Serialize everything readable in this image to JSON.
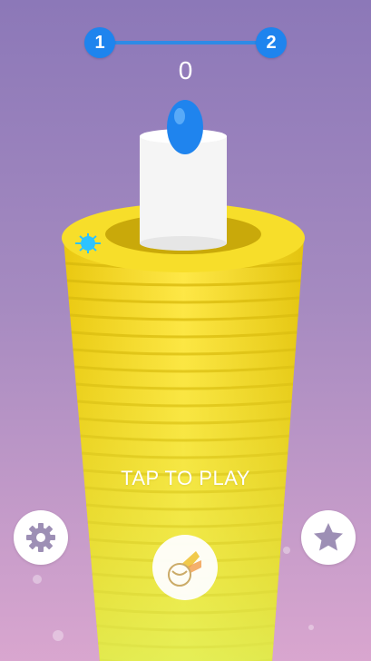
{
  "level": {
    "current": "1",
    "next": "2"
  },
  "score": "0",
  "prompt": "TAP TO PLAY",
  "buttons": {
    "settings_icon": "gear-icon",
    "favorites_icon": "star-icon",
    "ball_select_icon": "ball-icon"
  },
  "colors": {
    "background_top": "#8c78b8",
    "background_bottom": "#d9a6cf",
    "tower": "#f5d71a",
    "ball": "#1f84ee",
    "level_indicator": "#1e84ee"
  }
}
